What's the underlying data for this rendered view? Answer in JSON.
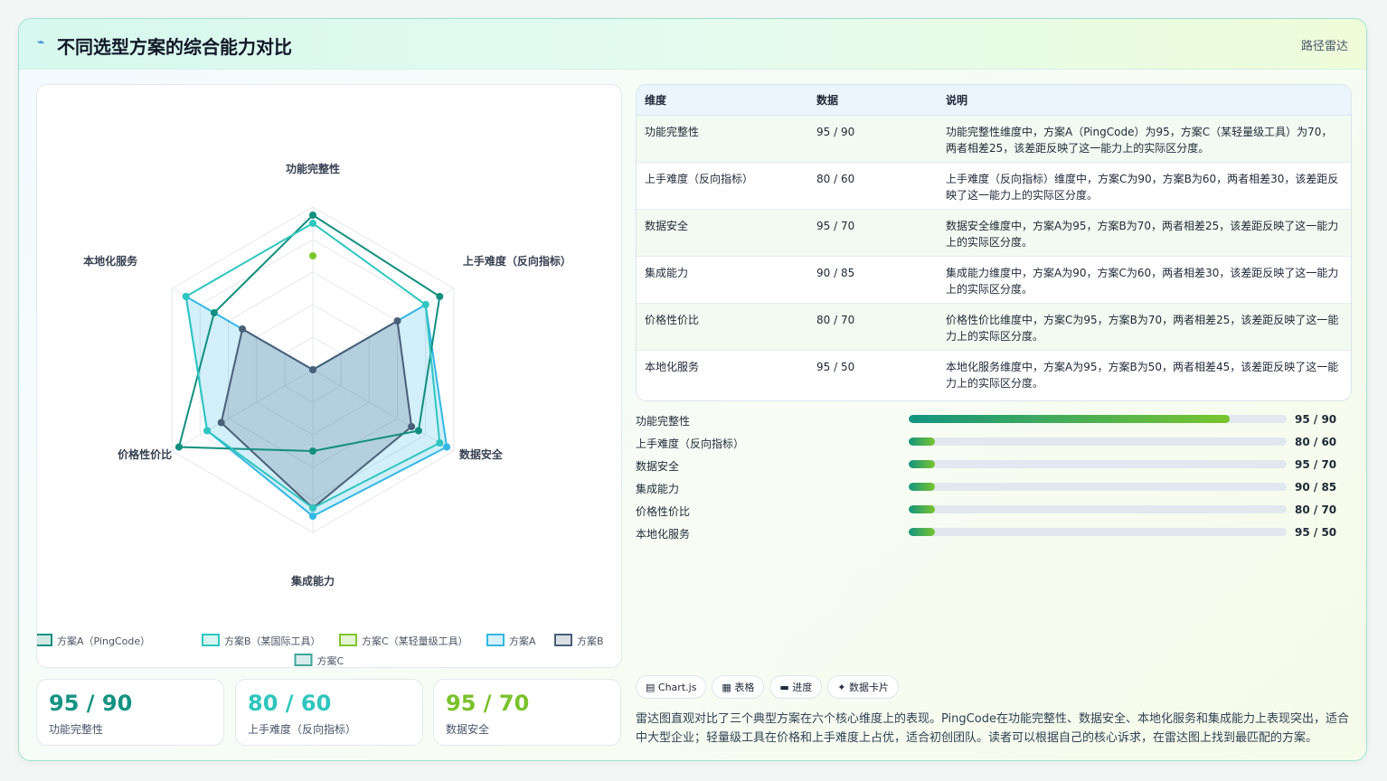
{
  "header": {
    "icon": "bolt-icon",
    "title": "不同选型方案的综合能力对比",
    "badge": "路径雷达"
  },
  "chart_data": {
    "type": "radar",
    "axes": [
      "功能完整性",
      "上手难度（反向指标）",
      "数据安全",
      "集成能力",
      "价格性价比",
      "本地化服务"
    ],
    "rmax": 100,
    "grid": true,
    "legend_position": "bottom",
    "series": [
      {
        "name": "方案A（PingCode）",
        "values": [
          95,
          90,
          75,
          50,
          95,
          70
        ],
        "color": "#138f7f",
        "fill": false
      },
      {
        "name": "方案B（某国际工具）",
        "values": [
          90,
          80,
          90,
          85,
          75,
          90
        ],
        "color": "#2fc6c0",
        "fill": false
      },
      {
        "name": "方案C（某轻量级工具）",
        "values": [
          70,
          null,
          null,
          null,
          null,
          null
        ],
        "color": "#7dc52c",
        "fill": false
      },
      {
        "name": "方案A",
        "values": [
          0,
          80,
          95,
          90,
          75,
          90
        ],
        "color": "#33b7e6",
        "fill": true
      },
      {
        "name": "方案B",
        "values": [
          0,
          60,
          70,
          85,
          65,
          50
        ],
        "color": "#4a5f78",
        "fill": true
      },
      {
        "name": "方案C",
        "values": [],
        "color": "#3da79a",
        "fill": true
      }
    ]
  },
  "stats": [
    {
      "value": "95 / 90",
      "label": "功能完整性",
      "color": "#149382"
    },
    {
      "value": "80 / 60",
      "label": "上手难度（反向指标）",
      "color": "#2ec6bd"
    },
    {
      "value": "95 / 70",
      "label": "数据安全",
      "color": "#7ac22c"
    }
  ],
  "table": {
    "headers": [
      "维度",
      "数据",
      "说明"
    ],
    "rows": [
      {
        "dim": "功能完整性",
        "data": "95 / 90",
        "desc": "功能完整性维度中，方案A（PingCode）为95，方案C（某轻量级工具）为70，两者相差25，该差距反映了这一能力上的实际区分度。"
      },
      {
        "dim": "上手难度（反向指标）",
        "data": "80 / 60",
        "desc": "上手难度（反向指标）维度中，方案C为90，方案B为60，两者相差30，该差距反映了这一能力上的实际区分度。"
      },
      {
        "dim": "数据安全",
        "data": "95 / 70",
        "desc": "数据安全维度中，方案A为95，方案B为70，两者相差25，该差距反映了这一能力上的实际区分度。"
      },
      {
        "dim": "集成能力",
        "data": "90 / 85",
        "desc": "集成能力维度中，方案A为90，方案C为60，两者相差30，该差距反映了这一能力上的实际区分度。"
      },
      {
        "dim": "价格性价比",
        "data": "80 / 70",
        "desc": "价格性价比维度中，方案C为95，方案B为70，两者相差25，该差距反映了这一能力上的实际区分度。"
      },
      {
        "dim": "本地化服务",
        "data": "95 / 50",
        "desc": "本地化服务维度中，方案A为95，方案B为50，两者相差45，该差距反映了这一能力上的实际区分度。"
      }
    ]
  },
  "bars": [
    {
      "name": "功能完整性",
      "value": "95 / 90",
      "fill_pct": 85
    },
    {
      "name": "上手难度（反向指标）",
      "value": "80 / 60",
      "fill_pct": 7
    },
    {
      "name": "数据安全",
      "value": "95 / 70",
      "fill_pct": 7
    },
    {
      "name": "集成能力",
      "value": "90 / 85",
      "fill_pct": 7
    },
    {
      "name": "价格性价比",
      "value": "80 / 70",
      "fill_pct": 7
    },
    {
      "name": "本地化服务",
      "value": "95 / 50",
      "fill_pct": 7
    }
  ],
  "chips": [
    {
      "icon": "chart-icon",
      "glyph": "▤",
      "label": "Chart.js"
    },
    {
      "icon": "table-icon",
      "glyph": "▦",
      "label": "表格"
    },
    {
      "icon": "progress-icon",
      "glyph": "▬",
      "label": "进度"
    },
    {
      "icon": "card-icon",
      "glyph": "✦",
      "label": "数据卡片"
    }
  ],
  "note": "雷达图直观对比了三个典型方案在六个核心维度上的表现。PingCode在功能完整性、数据安全、本地化服务和集成能力上表现突出，适合中大型企业；轻量级工具在价格和上手难度上占优，适合初创团队。读者可以根据自己的核心诉求，在雷达图上找到最匹配的方案。"
}
